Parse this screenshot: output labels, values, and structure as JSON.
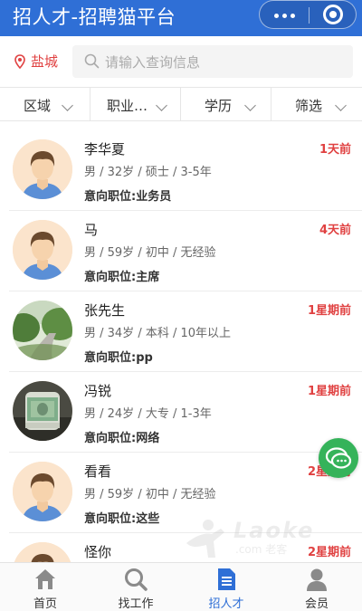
{
  "header": {
    "title": "招人才-招聘猫平台"
  },
  "search": {
    "city": "盐城",
    "placeholder": "请输入查询信息"
  },
  "filters": [
    "区域",
    "职业…",
    "学历",
    "筛选"
  ],
  "candidates": [
    {
      "name": "李华夏",
      "meta": "男 / 32岁 / 硕士 / 3-5年",
      "intent": "意向职位:业务员",
      "time": "1天前",
      "avatar": "default"
    },
    {
      "name": "马",
      "meta": "男 / 59岁 / 初中 / 无经验",
      "intent": "意向职位:主席",
      "time": "4天前",
      "avatar": "default"
    },
    {
      "name": "张先生",
      "meta": "男 / 34岁 / 本科 / 10年以上",
      "intent": "意向职位:pp",
      "time": "1星期前",
      "avatar": "photo-road"
    },
    {
      "name": "冯锐",
      "meta": "男 / 24岁 / 大专 / 1-3年",
      "intent": "意向职位:网络",
      "time": "1星期前",
      "avatar": "photo-cash"
    },
    {
      "name": "看看",
      "meta": "男 / 59岁 / 初中 / 无经验",
      "intent": "意向职位:这些",
      "time": "2星期前",
      "avatar": "default"
    },
    {
      "name": "怪你",
      "meta": "",
      "intent": "",
      "time": "2星期前",
      "avatar": "default"
    }
  ],
  "watermark": {
    "text": "Laoke",
    "sub": ".com 老客"
  },
  "tabbar": {
    "items": [
      {
        "label": "首页",
        "icon": "home-icon"
      },
      {
        "label": "找工作",
        "icon": "search-icon"
      },
      {
        "label": "招人才",
        "icon": "document-icon"
      },
      {
        "label": "会员",
        "icon": "user-icon"
      }
    ],
    "active": 2
  },
  "colors": {
    "primary": "#2f6fd6",
    "accent_red": "#e04141",
    "chat_green": "#35b35a"
  }
}
